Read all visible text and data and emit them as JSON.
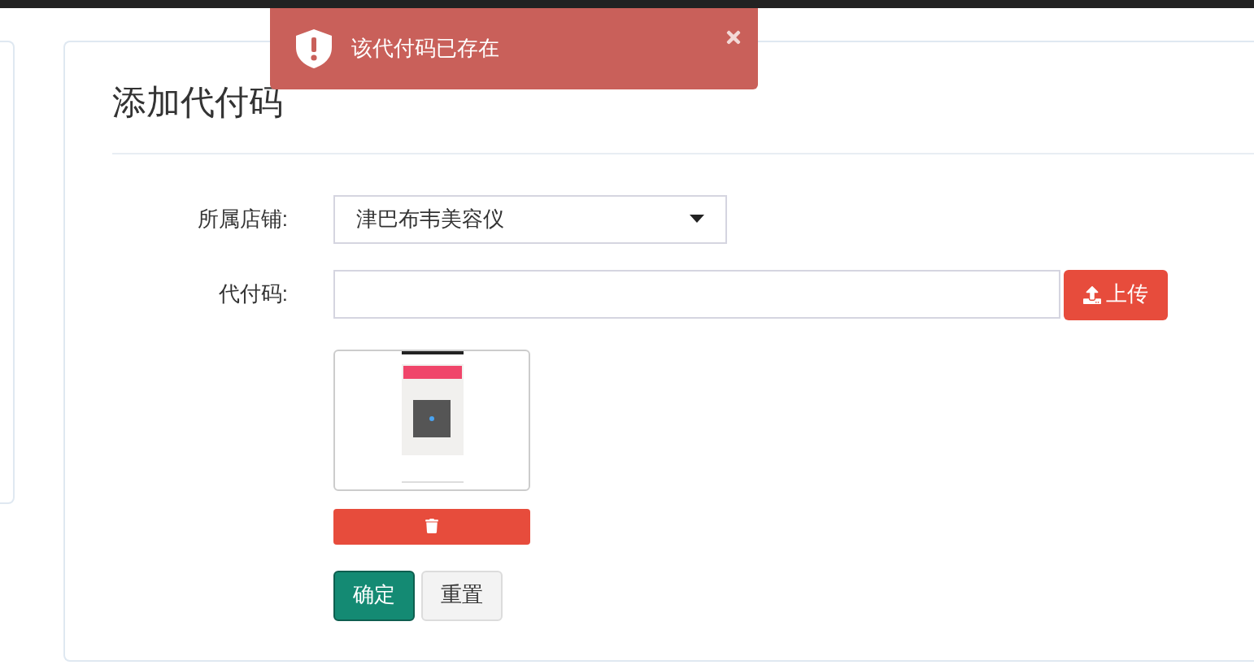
{
  "toast": {
    "message": "该代付码已存在",
    "kind": "error"
  },
  "form": {
    "title": "添加代付码",
    "fields": [
      {
        "kind": "select",
        "label": "所属店铺:",
        "value": "津巴布韦美容仪"
      },
      {
        "kind": "upload",
        "label": "代付码:",
        "button": "上传"
      }
    ],
    "buttons": [
      {
        "label": "确定",
        "kind": "primary"
      },
      {
        "label": "重置",
        "kind": "default"
      }
    ]
  }
}
